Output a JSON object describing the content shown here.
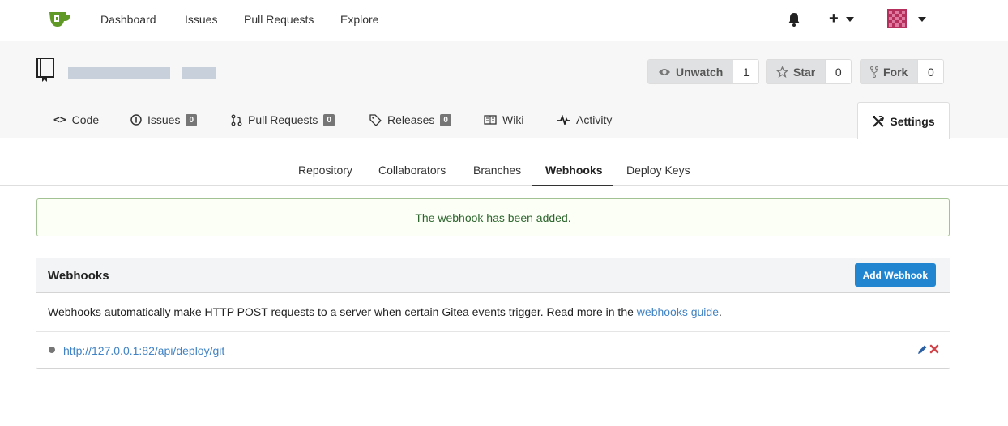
{
  "nav": {
    "links": [
      "Dashboard",
      "Issues",
      "Pull Requests",
      "Explore"
    ],
    "icons": {
      "logo": "gitea-cup-icon",
      "notifications": "bell-icon",
      "create": "plus-icon",
      "profile": "avatar"
    },
    "plus_label": "+"
  },
  "repo": {
    "watch_label": "Unwatch",
    "watch_count": "1",
    "star_label": "Star",
    "star_count": "0",
    "fork_label": "Fork",
    "fork_count": "0"
  },
  "tabs": {
    "code": "Code",
    "issues": "Issues",
    "issues_count": "0",
    "pulls": "Pull Requests",
    "pulls_count": "0",
    "releases": "Releases",
    "releases_count": "0",
    "wiki": "Wiki",
    "activity": "Activity",
    "settings": "Settings"
  },
  "settings_menu": {
    "items": [
      "Repository",
      "Collaborators",
      "Branches",
      "Webhooks",
      "Deploy Keys"
    ],
    "active": "Webhooks"
  },
  "alert": {
    "message": "The webhook has been added."
  },
  "webhooks": {
    "title": "Webhooks",
    "add_button": "Add Webhook",
    "description_prefix": "Webhooks automatically make HTTP POST requests to a server when certain Gitea events trigger. Read more in the ",
    "guide_link": "webhooks guide",
    "description_suffix": ".",
    "items": [
      {
        "url": "http://127.0.0.1:82/api/deploy/git"
      }
    ]
  },
  "colors": {
    "accent": "#2185d0",
    "link": "#4183c4",
    "success_bg": "#fcfff5",
    "success_border": "#a3c293",
    "success_text": "#2c662d",
    "logo_green": "#609926"
  }
}
